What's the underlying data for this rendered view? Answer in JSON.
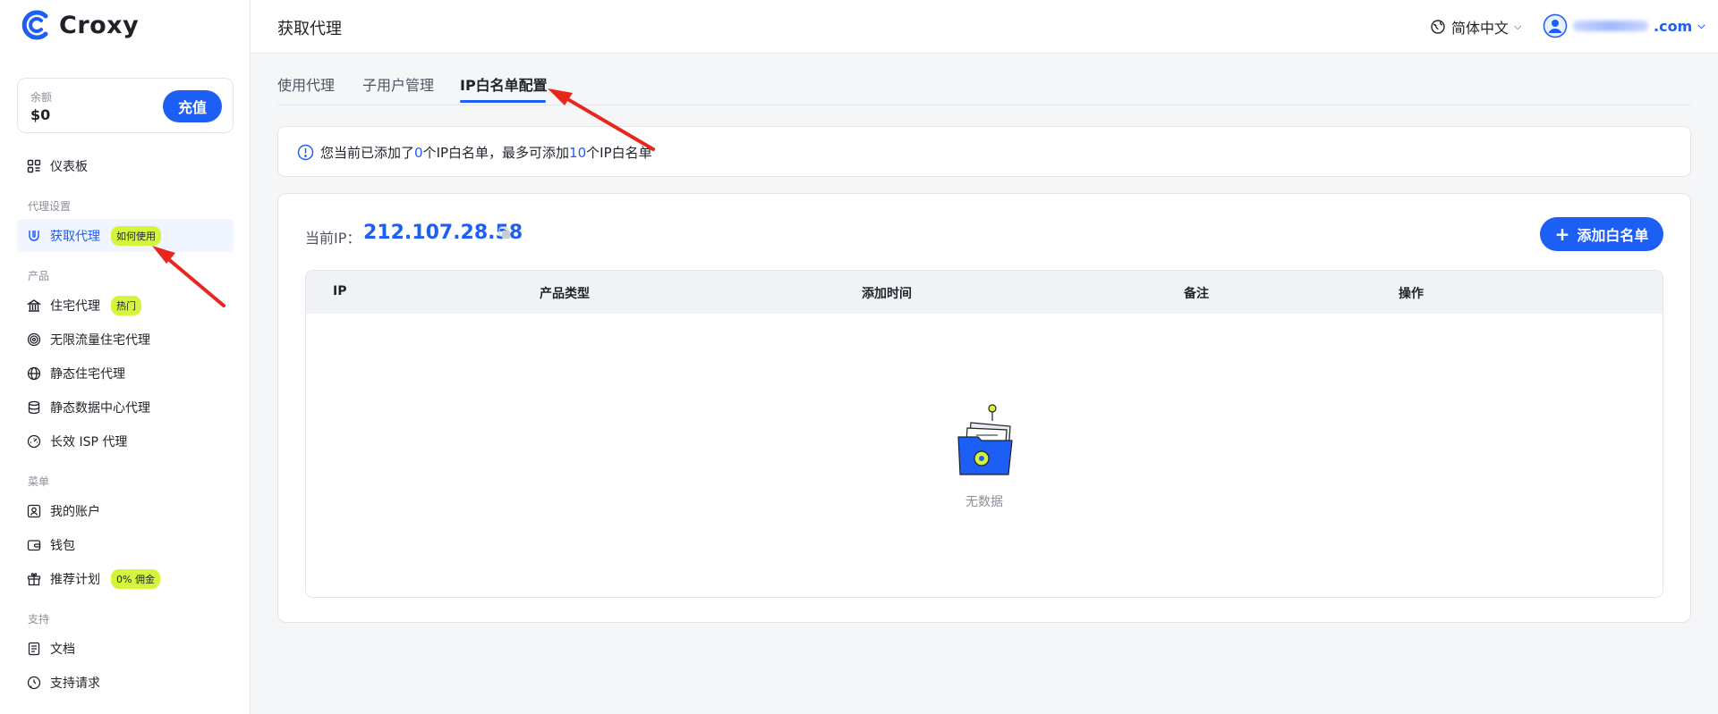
{
  "brand": {
    "name": "Croxy"
  },
  "balance": {
    "label": "余额",
    "value": "$0",
    "topup_label": "充值"
  },
  "nav": {
    "dashboard": "仪表板",
    "section_proxy": "代理设置",
    "get_proxy": "获取代理",
    "get_proxy_badge": "如何使用",
    "section_products": "产品",
    "residential": "住宅代理",
    "residential_badge": "热门",
    "unlimited": "无限流量住宅代理",
    "static_residential": "静态住宅代理",
    "static_datacenter": "静态数据中心代理",
    "long_isp": "长效 ISP 代理",
    "section_menu": "菜单",
    "account": "我的账户",
    "wallet": "钱包",
    "referral": "推荐计划",
    "referral_badge": "0% 佣金",
    "section_support": "支持",
    "docs": "文档",
    "support_request": "支持请求"
  },
  "header": {
    "title": "获取代理",
    "language": "简体中文",
    "user_suffix": ".com"
  },
  "tabs": [
    {
      "label": "使用代理"
    },
    {
      "label": "子用户管理"
    },
    {
      "label": "IP白名单配置"
    }
  ],
  "notice": {
    "part1": "您当前已添加了",
    "count": "0",
    "part2": "个IP白名单，最多可添加",
    "max": "10",
    "part3": "个IP白名单"
  },
  "whitelist": {
    "current_ip_label": "当前IP：",
    "current_ip": "212.107.28.58",
    "add_label": "添加白名单",
    "columns": [
      "IP",
      "产品类型",
      "添加时间",
      "备注",
      "操作"
    ],
    "empty_text": "无数据"
  },
  "colors": {
    "accent": "#1d5ef5",
    "badge": "#d4f53a",
    "arrow": "#e8261c"
  }
}
